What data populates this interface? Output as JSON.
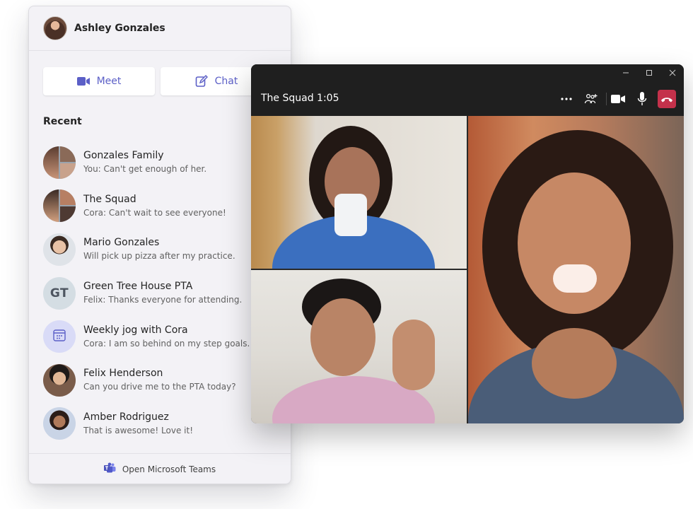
{
  "user": {
    "name": "Ashley Gonzales"
  },
  "actions": {
    "meet_label": "Meet",
    "chat_label": "Chat"
  },
  "recent": {
    "title": "Recent",
    "items": [
      {
        "name": "Gonzales Family",
        "preview": "You: Can't get enough of her.",
        "avatar": "group-photo-avatar"
      },
      {
        "name": "The Squad",
        "preview": "Cora: Can't wait to see everyone!",
        "avatar": "group-photo-avatar"
      },
      {
        "name": "Mario Gonzales",
        "preview": "Will pick up pizza after my practice.",
        "avatar": "photo-avatar"
      },
      {
        "name": "Green Tree House PTA",
        "preview": "Felix: Thanks everyone for attending.",
        "avatar_initials": "GT"
      },
      {
        "name": "Weekly jog with Cora",
        "preview": "Cora: I am so behind on my step goals.",
        "avatar": "calendar-icon"
      },
      {
        "name": "Felix Henderson",
        "preview": "Can you drive me to the PTA today?",
        "avatar": "photo-avatar"
      },
      {
        "name": "Amber Rodriguez",
        "preview": "That is awesome! Love it!",
        "avatar": "photo-avatar"
      }
    ]
  },
  "footer": {
    "label": "Open Microsoft Teams",
    "icon": "teams-icon"
  },
  "call": {
    "title": "The Squad 1:05",
    "controls": [
      "more-options-icon",
      "add-people-icon",
      "camera-icon",
      "microphone-icon",
      "hang-up-icon"
    ],
    "window_controls": [
      "minimize-icon",
      "maximize-icon",
      "close-icon"
    ],
    "hangup_color": "#c4314b"
  },
  "colors": {
    "accent": "#5b5fc7",
    "panel_bg": "#f3f2f6",
    "call_bg": "#1f1f1f"
  }
}
